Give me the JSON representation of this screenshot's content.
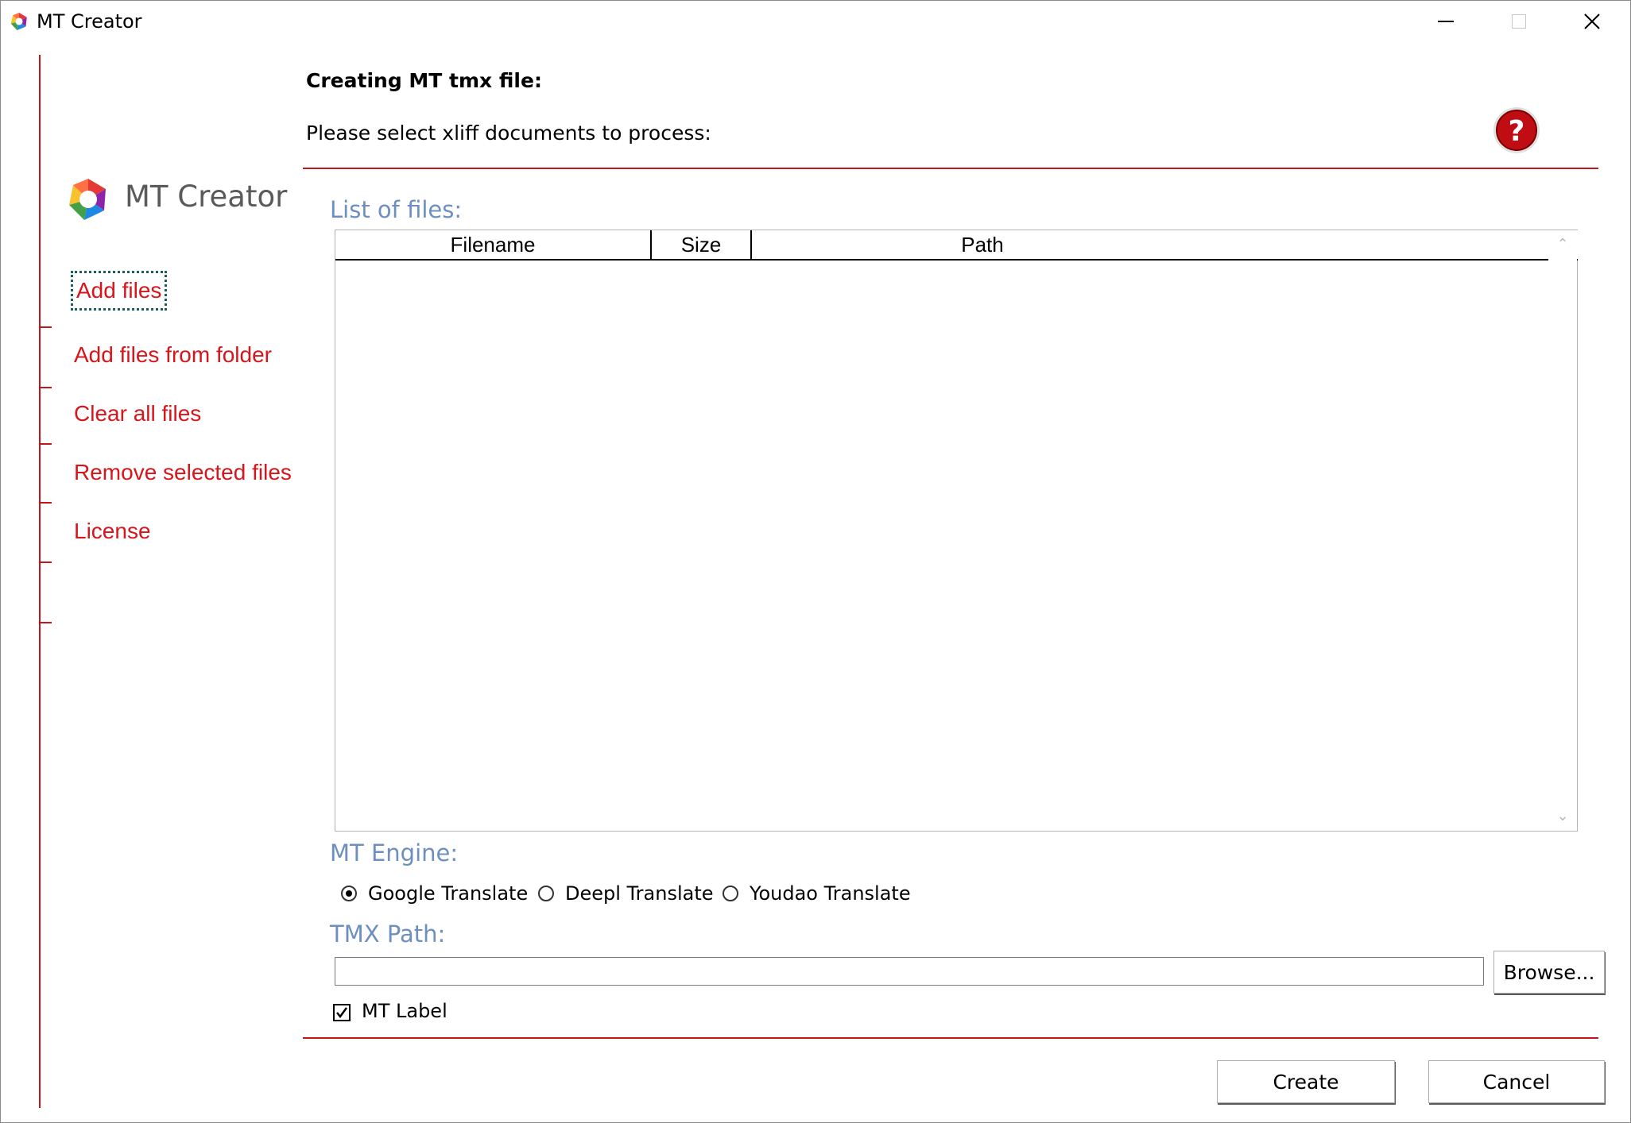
{
  "window": {
    "title": "MT Creator"
  },
  "brand": {
    "name": "MT Creator",
    "colors": [
      "#e53935",
      "#fbc02d",
      "#43a047",
      "#1e88e5",
      "#8e24aa"
    ]
  },
  "sidebar": {
    "items": [
      {
        "label": "Add files"
      },
      {
        "label": "Add files from folder"
      },
      {
        "label": "Clear all files"
      },
      {
        "label": "Remove selected files"
      },
      {
        "label": "License"
      }
    ]
  },
  "header": {
    "title": "Creating MT tmx file:",
    "subtitle": "Please select xliff documents to process:"
  },
  "files": {
    "label": "List of files:",
    "columns": [
      "Filename",
      "Size",
      "Path"
    ],
    "rows": []
  },
  "engine": {
    "label": "MT Engine:",
    "options": [
      {
        "label": "Google Translate",
        "selected": true
      },
      {
        "label": "Deepl Translate",
        "selected": false
      },
      {
        "label": "Youdao Translate",
        "selected": false
      }
    ]
  },
  "tmx": {
    "label": "TMX Path:",
    "value": "",
    "browse_label": "Browse..."
  },
  "mt_label": {
    "label": "MT Label",
    "checked": true
  },
  "footer": {
    "create_label": "Create",
    "cancel_label": "Cancel"
  },
  "theme": {
    "accent": "#c0161c",
    "link": "#d8151b",
    "section": "#6d8fc0"
  }
}
